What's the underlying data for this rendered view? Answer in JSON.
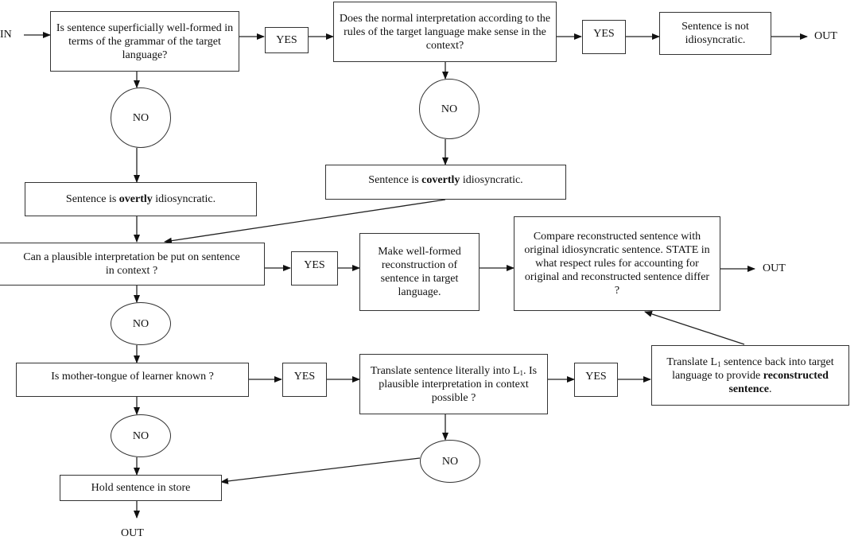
{
  "diagram": {
    "type": "flowchart",
    "terminals": {
      "in": "IN",
      "out": "OUT"
    },
    "nodes": {
      "q_wellformed": {
        "text": "Is sentence superficially well-formed in terms of the grammar of the target language?"
      },
      "yes1": {
        "text": "YES"
      },
      "q_normal_interp": {
        "text": "Does the normal interpretation according to the rules of the target language make sense in the context?"
      },
      "yes2": {
        "text": "YES"
      },
      "not_idio": {
        "text": "Sentence is not idiosyncratic."
      },
      "no1": {
        "text": "NO"
      },
      "no2": {
        "text": "NO"
      },
      "overtly": {
        "pre": "Sentence is ",
        "bold": "overtly",
        "post": " idiosyncratic."
      },
      "covertly": {
        "pre": "Sentence is ",
        "bold": "covertly",
        "post": " idiosyncratic."
      },
      "q_plausible": {
        "text": "Can a plausible interpretation be put on sentence in context ?"
      },
      "yes3": {
        "text": "YES"
      },
      "make_wellformed": {
        "text": "Make well-formed reconstruction of sentence in target language."
      },
      "compare": {
        "text": "Compare reconstructed sentence with original idiosyncratic sentence. STATE in what respect rules for accounting for original and reconstructed sentence differ ?"
      },
      "no3": {
        "text": "NO"
      },
      "q_mother_tongue": {
        "text": "Is mother-tongue of learner known ?"
      },
      "yes4": {
        "text": "YES"
      },
      "translate_literal": {
        "pre": "Translate sentence literally into L",
        "sub": "1",
        "post": ". Is plausible interpretation in context possible ?"
      },
      "yes5": {
        "text": "YES"
      },
      "translate_back": {
        "pre": "Translate L",
        "sub": "1",
        "mid": " sentence back into target language to provide ",
        "bold": "reconstructed sentence",
        "post": "."
      },
      "no4": {
        "text": "NO"
      },
      "no5": {
        "text": "NO"
      },
      "hold": {
        "text": "Hold sentence in store"
      }
    },
    "edges": [
      [
        "IN",
        "q_wellformed"
      ],
      [
        "q_wellformed",
        "yes1"
      ],
      [
        "yes1",
        "q_normal_interp"
      ],
      [
        "q_normal_interp",
        "yes2"
      ],
      [
        "yes2",
        "not_idio"
      ],
      [
        "not_idio",
        "OUT"
      ],
      [
        "q_wellformed",
        "no1"
      ],
      [
        "no1",
        "overtly"
      ],
      [
        "q_normal_interp",
        "no2"
      ],
      [
        "no2",
        "covertly"
      ],
      [
        "overtly",
        "q_plausible"
      ],
      [
        "covertly",
        "q_plausible"
      ],
      [
        "q_plausible",
        "yes3"
      ],
      [
        "yes3",
        "make_wellformed"
      ],
      [
        "make_wellformed",
        "compare"
      ],
      [
        "compare",
        "OUT"
      ],
      [
        "q_plausible",
        "no3"
      ],
      [
        "no3",
        "q_mother_tongue"
      ],
      [
        "q_mother_tongue",
        "yes4"
      ],
      [
        "yes4",
        "translate_literal"
      ],
      [
        "translate_literal",
        "yes5"
      ],
      [
        "yes5",
        "translate_back"
      ],
      [
        "translate_back",
        "compare"
      ],
      [
        "q_mother_tongue",
        "no4"
      ],
      [
        "no4",
        "hold"
      ],
      [
        "translate_literal",
        "no5"
      ],
      [
        "no5",
        "hold"
      ],
      [
        "hold",
        "OUT"
      ]
    ]
  }
}
